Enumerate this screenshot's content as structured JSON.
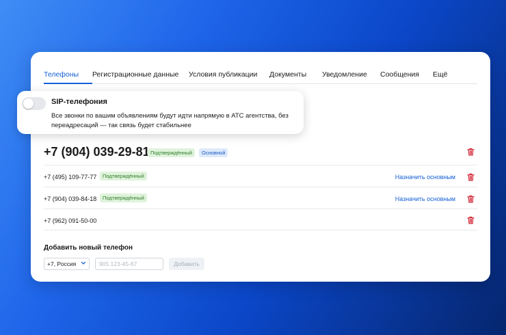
{
  "tabs": [
    {
      "label": "Телефоны",
      "active": true
    },
    {
      "label": "Регистрационные данные"
    },
    {
      "label": "Условия публикации"
    },
    {
      "label": "Документы"
    },
    {
      "label": "Уведомление"
    },
    {
      "label": "Сообщения"
    },
    {
      "label": "Ещё"
    }
  ],
  "sip": {
    "title": "SIP-телефония",
    "description": "Все звонки по вашим объявлениям будут идти напрямую в АТС агентства, без переадресаций — так связь будет стабильнее",
    "enabled": false
  },
  "phones": [
    {
      "number": "+7 (904) 039-29-81",
      "badges": [
        "Подтверждённый",
        "Основной"
      ]
    },
    {
      "number": "+7 (495) 109-77-77",
      "badges": [
        "Подтверждённый"
      ],
      "action": "Назначить основным"
    },
    {
      "number": "+7 (904) 039-84-18",
      "badges": [
        "Подтверждённый"
      ],
      "action": "Назначить основным"
    },
    {
      "number": "+7 (962) 091-50-00",
      "badges": []
    }
  ],
  "add_phone": {
    "title": "Добавить новый телефон",
    "country": "+7, Россия",
    "placeholder": "905 123-45-67",
    "button": "Добавить"
  },
  "colors": {
    "accent": "#1560d6",
    "delete": "#d11a2a",
    "confirmed_bg": "#dff3db",
    "main_bg": "#dde9fb"
  }
}
